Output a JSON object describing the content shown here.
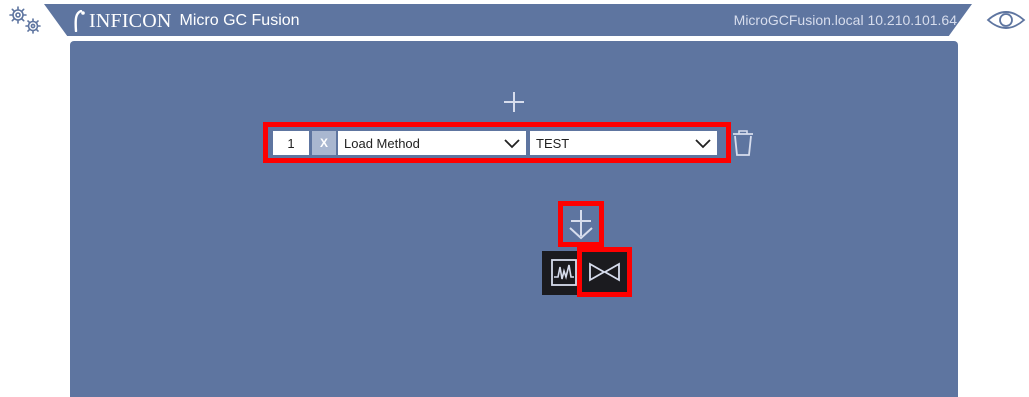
{
  "header": {
    "brand_name": "INFICON",
    "product_name": "Micro GC Fusion",
    "host_info": "MicroGCFusion.local 10.210.101.64"
  },
  "icons": {
    "settings": "gears-icon",
    "view": "eye-icon",
    "add": "plus-icon",
    "add_below": "plus-arrow-down-icon",
    "delete": "trash-icon",
    "chromatogram": "chromatogram-icon",
    "valve": "valve-icon",
    "dropdown": "chevron-down-icon"
  },
  "sequence": {
    "step": {
      "number": "1",
      "remove_label": "X",
      "action": "Load Method",
      "parameter": "TEST"
    }
  },
  "colors": {
    "header_bg": "#5e75a0",
    "panel_bg": "#5e75a0",
    "highlight": "#ff0000",
    "dark_button": "#1b1b1f"
  }
}
